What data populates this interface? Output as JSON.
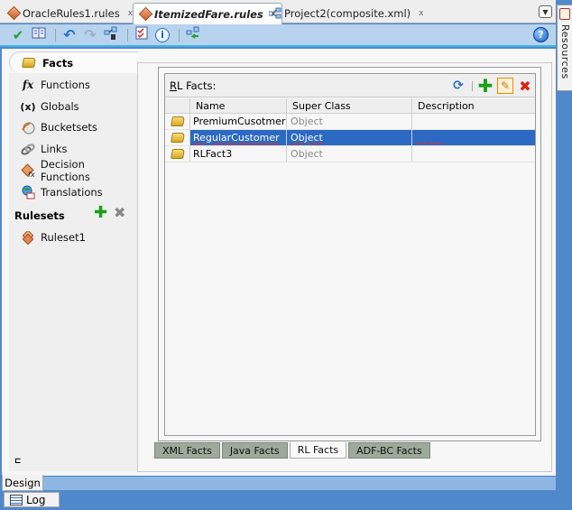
{
  "tabs": [
    {
      "label": "OracleRules1.rules",
      "icon": "rules-diamond-icon",
      "active": false
    },
    {
      "label": "ItemizedFare.rules",
      "icon": "rules-diamond-icon",
      "active": true
    },
    {
      "label": "Project2(composite.xml)",
      "icon": "composite-icon",
      "active": false
    }
  ],
  "tab_close_glyph": "x",
  "toolbar": {
    "buttons": [
      "validate-check-icon",
      "dictionary-book-icon",
      "undo-icon",
      "redo-icon",
      "link-icon",
      "checklist-icon",
      "info-icon",
      "link-back-icon"
    ],
    "help_label": "?"
  },
  "side_panel": {
    "resources_label": "Resources"
  },
  "nav": {
    "items": [
      {
        "label": "Facts",
        "icon": "facts-book-icon",
        "active": true
      },
      {
        "label": "Functions",
        "icon": "fx-icon"
      },
      {
        "label": "Globals",
        "icon": "variable-x-icon"
      },
      {
        "label": "Bucketsets",
        "icon": "bucketsets-icon"
      },
      {
        "label": "Links",
        "icon": "links-icon"
      },
      {
        "label": "Decision Functions",
        "icon": "decision-function-icon"
      },
      {
        "label": "Translations",
        "icon": "translations-icon"
      }
    ],
    "rulesets_header": "Rulesets",
    "rulesets": [
      {
        "label": "Ruleset1",
        "icon": "ruleset-icon"
      }
    ],
    "collapse_glyph": "⊏"
  },
  "facts_panel": {
    "title_mnemonic": "R",
    "title_rest": "L Facts:",
    "columns": [
      "",
      "Name",
      "Super Class",
      "Description"
    ],
    "rows": [
      {
        "name": "PremiumCusotmer",
        "super_class": "Object",
        "description": "",
        "selected": false
      },
      {
        "name": "RegularCustomer",
        "super_class": "Object",
        "description": "",
        "selected": true
      },
      {
        "name": "RLFact3",
        "super_class": "Object",
        "description": "",
        "selected": false
      }
    ],
    "actions": [
      "refresh-icon",
      "add-icon",
      "edit-pencil-icon",
      "delete-icon"
    ],
    "type_tabs": [
      {
        "label": "XML Facts",
        "active": false
      },
      {
        "label": "Java Facts",
        "active": false
      },
      {
        "label": "RL Facts",
        "active": true
      },
      {
        "label": "ADF-BC Facts",
        "active": false
      }
    ]
  },
  "bottom": {
    "design_tab": "Design",
    "log_tab": "Log"
  },
  "colors": {
    "selection": "#2b69c3",
    "toolbar_bg": "#b7d3ee",
    "frame_blue": "#5088cc",
    "inactive_tab_green": "#9ea99a"
  }
}
